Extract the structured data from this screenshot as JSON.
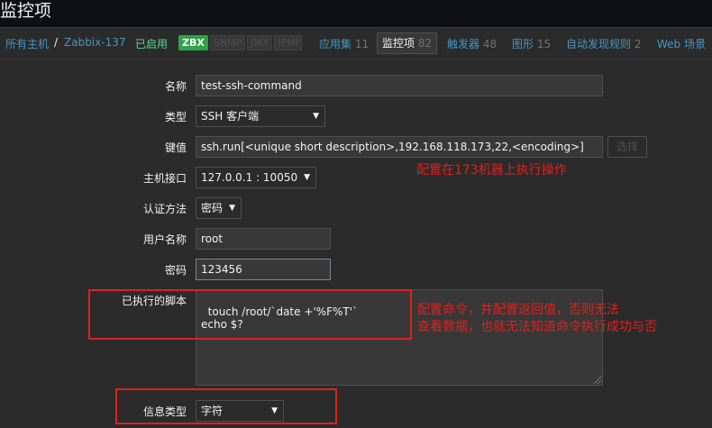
{
  "header": {
    "title": "监控项"
  },
  "nav": {
    "all_hosts": "所有主机",
    "separator": "/",
    "host": "Zabbix-137",
    "status": "已启用",
    "availability": [
      "ZBX",
      "SNMP",
      "JMX",
      "IPMI"
    ],
    "tabs": [
      {
        "label": "应用集",
        "count": "11"
      },
      {
        "label": "监控项",
        "count": "82"
      },
      {
        "label": "触发器",
        "count": "48"
      },
      {
        "label": "图形",
        "count": "15"
      },
      {
        "label": "自动发现规则",
        "count": "2"
      },
      {
        "label": "Web 场景",
        "count": ""
      }
    ]
  },
  "form": {
    "name_label": "名称",
    "name_value": "test-ssh-command",
    "type_label": "类型",
    "type_value": "SSH 客户端",
    "key_label": "键值",
    "key_value": "ssh.run[<unique short description>,192.168.118.173,22,<encoding>]",
    "key_select_button": "选择",
    "interface_label": "主机接口",
    "interface_value": "127.0.0.1 : 10050",
    "auth_label": "认证方法",
    "auth_value": "密码",
    "username_label": "用户名称",
    "username_value": "root",
    "password_label": "密码",
    "password_value": "123456",
    "script_label": "已执行的脚本",
    "script_value": "touch /root/`date +'%F%T'`\necho $?",
    "info_type_label": "信息类型",
    "info_type_value": "字符"
  },
  "annotations": {
    "note1": "配置在173机器上执行操作",
    "note2_line1": "配置命令，并配置返回值，否则无法",
    "note2_line2": "查看数据，也就无法知道命令执行成功与否"
  },
  "colors": {
    "link": "#4796c4",
    "enabled": "#59db8f",
    "zbx_available": "#2ea347",
    "annotation": "#e0201c"
  }
}
